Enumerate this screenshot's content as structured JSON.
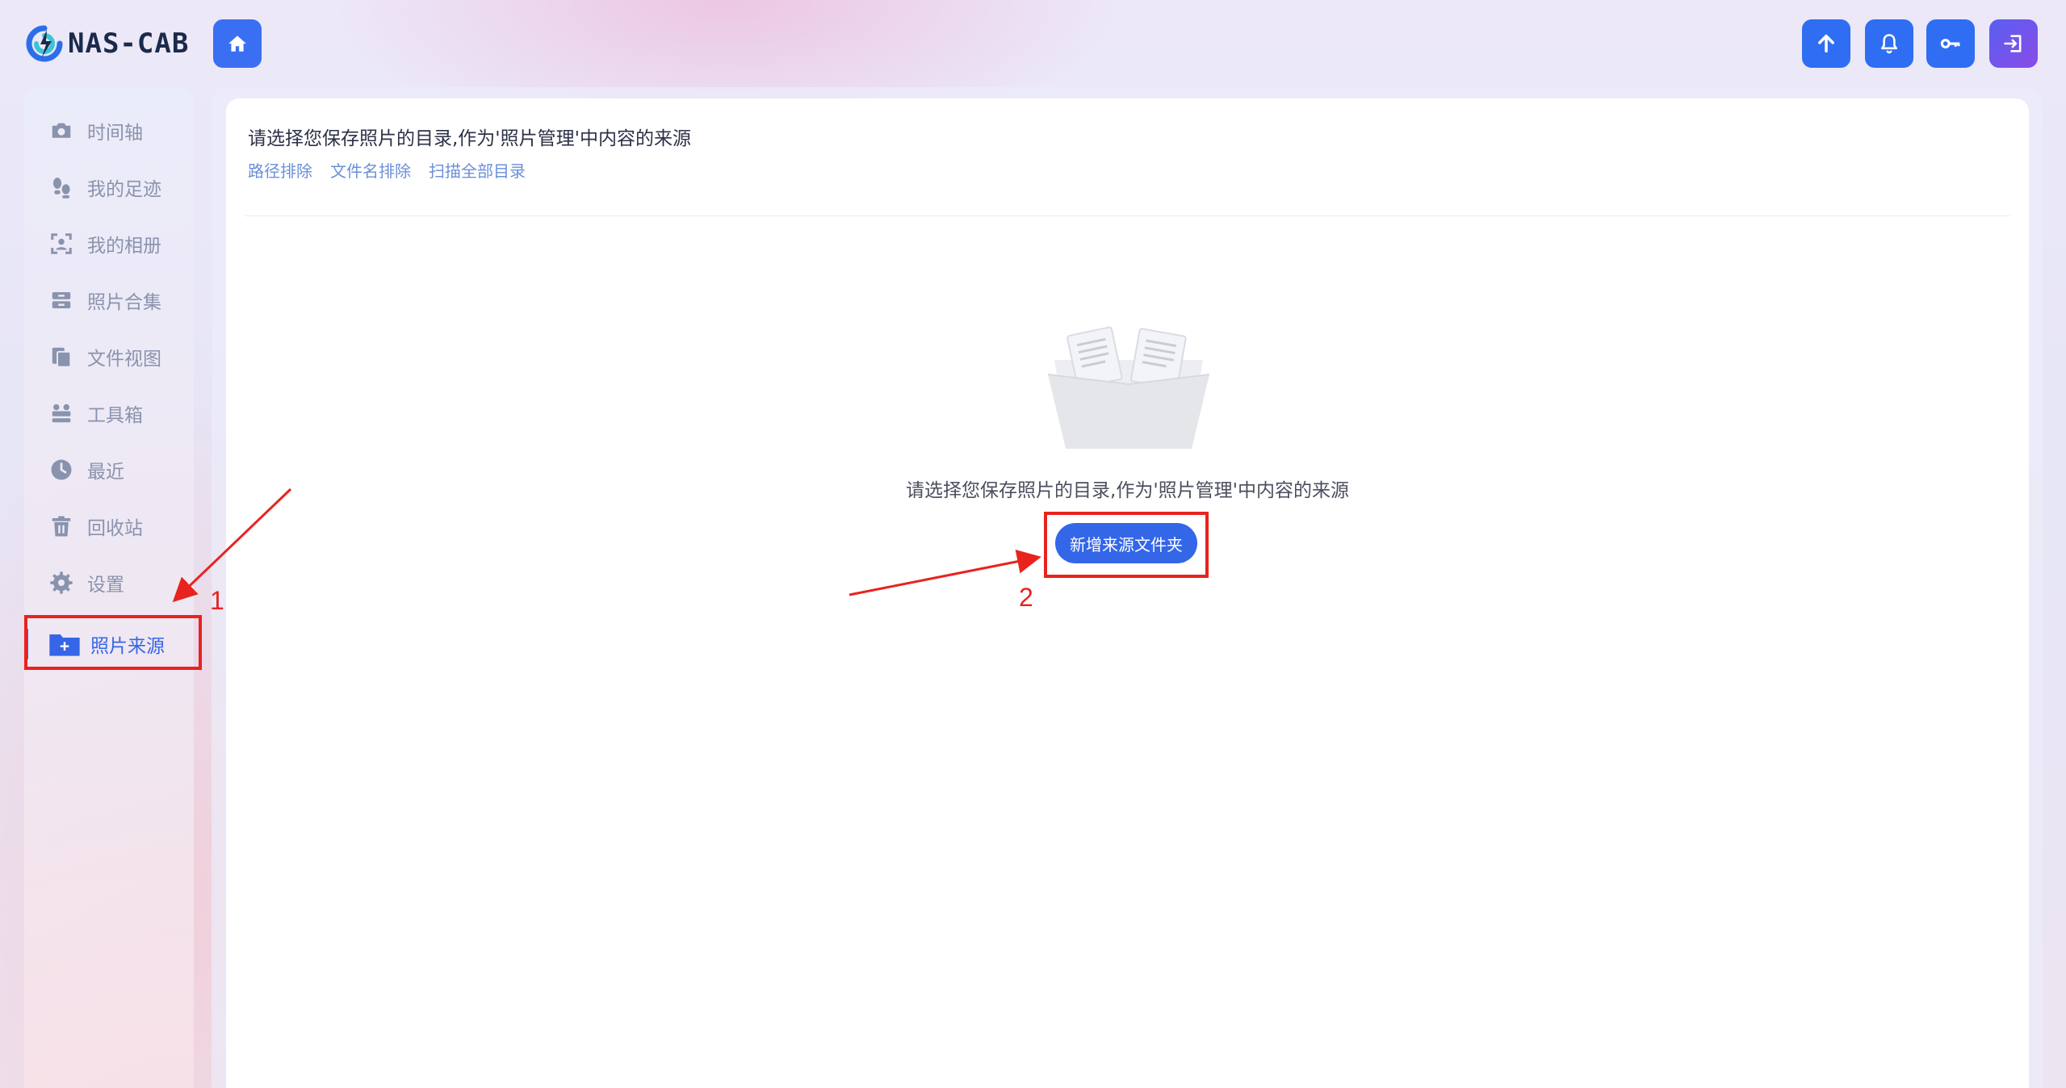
{
  "app": {
    "logo_text": "NAS-CAB"
  },
  "header": {
    "home_icon": "home-icon",
    "actions": [
      {
        "icon": "upload-arrow-icon"
      },
      {
        "icon": "bell-icon"
      },
      {
        "icon": "key-icon"
      },
      {
        "icon": "logout-icon"
      }
    ],
    "colors": {
      "button": "#2f6df2",
      "logout_start": "#5a5ff0",
      "logout_end": "#8a4be8"
    }
  },
  "sidebar": {
    "items": [
      {
        "label": "时间轴",
        "icon": "camera-icon"
      },
      {
        "label": "我的足迹",
        "icon": "footprints-icon"
      },
      {
        "label": "我的相册",
        "icon": "face-scan-icon"
      },
      {
        "label": "照片合集",
        "icon": "archive-icon"
      },
      {
        "label": "文件视图",
        "icon": "copy-files-icon"
      },
      {
        "label": "工具箱",
        "icon": "toolbox-icon"
      },
      {
        "label": "最近",
        "icon": "clock-icon"
      },
      {
        "label": "回收站",
        "icon": "trash-icon"
      },
      {
        "label": "设置",
        "icon": "gear-icon"
      },
      {
        "label": "照片来源",
        "icon": "folder-plus-icon",
        "active": true
      }
    ],
    "active_color": "#3566e8"
  },
  "main": {
    "title": "请选择您保存照片的目录,作为'照片管理'中内容的来源",
    "links": [
      "路径排除",
      "文件名排除",
      "扫描全部目录"
    ],
    "empty_text": "请选择您保存照片的目录,作为'照片管理'中内容的来源",
    "add_button": "新增来源文件夹"
  },
  "annotations": {
    "labels": [
      "1",
      "2"
    ],
    "color": "#e8231e"
  }
}
